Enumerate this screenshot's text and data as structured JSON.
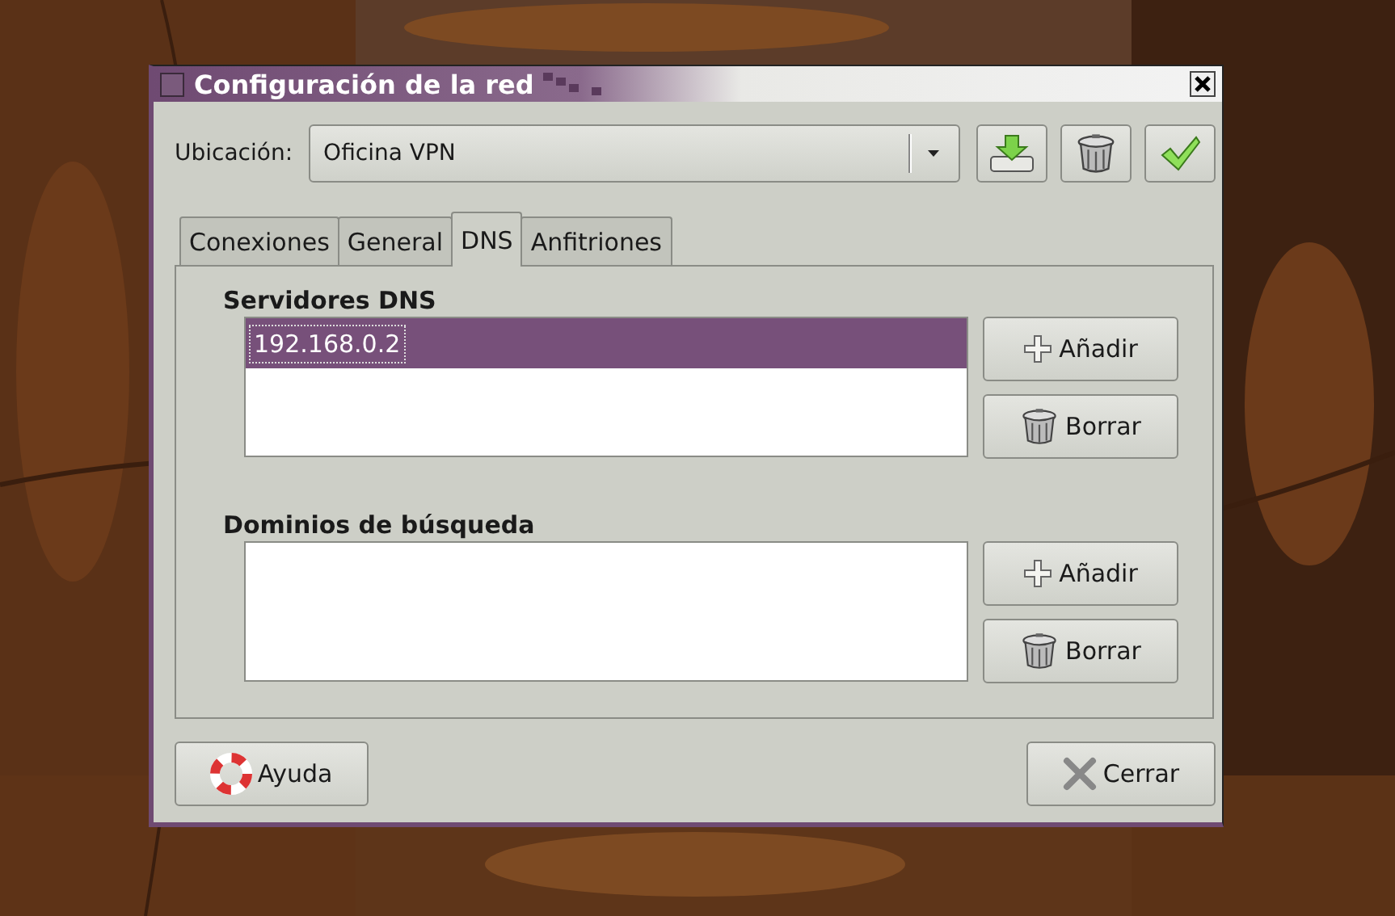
{
  "window": {
    "title": "Configuración de la red"
  },
  "location": {
    "label": "Ubicación:",
    "value": "Oficina VPN"
  },
  "tabs": [
    {
      "label": "Conexiones",
      "selected": false
    },
    {
      "label": "General",
      "selected": false
    },
    {
      "label": "DNS",
      "selected": true
    },
    {
      "label": "Anfitriones",
      "selected": false
    }
  ],
  "sections": [
    {
      "title": "Servidores DNS",
      "items": [
        {
          "text": "192.168.0.2",
          "selected": true
        }
      ],
      "buttons": [
        {
          "label": "Añadir",
          "kind": "add"
        },
        {
          "label": "Borrar",
          "kind": "delete"
        }
      ]
    },
    {
      "title": "Dominios de búsqueda",
      "buttons": [
        {
          "label": "Añadir",
          "kind": "add"
        },
        {
          "label": "Borrar",
          "kind": "delete"
        }
      ]
    }
  ],
  "footer": [
    {
      "label": "Ayuda",
      "kind": "help"
    },
    {
      "label": "Cerrar",
      "kind": "close"
    }
  ]
}
